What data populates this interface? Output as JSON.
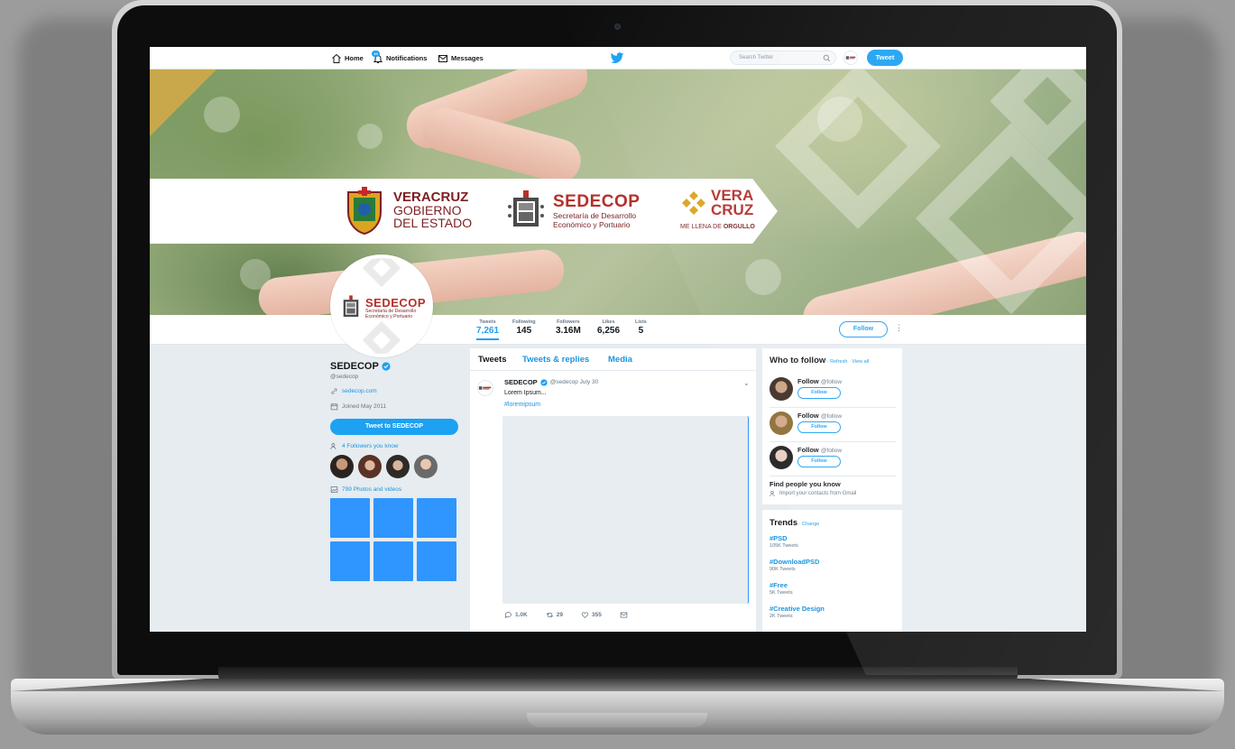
{
  "nav": {
    "home": "Home",
    "notifications": "Notifications",
    "notifications_count": "10",
    "messages": "Messages",
    "search_placeholder": "Search Twitter",
    "tweet_button": "Tweet"
  },
  "banner": {
    "veracruz_line1": "VERACRUZ",
    "veracruz_line2": "GOBIERNO",
    "veracruz_line3": "DEL ESTADO",
    "sedecop_title": "SEDECOP",
    "sedecop_sub1": "Secretaría de Desarrollo",
    "sedecop_sub2": "Económico y Portuario",
    "vc_line1": "VERA",
    "vc_line2": "CRUZ",
    "vc_tagline_a": "ME LLENA DE ",
    "vc_tagline_b": "ORGULLO"
  },
  "stats": [
    {
      "label": "Tweets",
      "value": "7,261"
    },
    {
      "label": "Following",
      "value": "145"
    },
    {
      "label": "Followers",
      "value": "3.16M"
    },
    {
      "label": "Likes",
      "value": "6,256"
    },
    {
      "label": "Lists",
      "value": "5"
    }
  ],
  "profile": {
    "name": "SEDECOP",
    "handle": "@sedecop",
    "website": "sedecop.com",
    "joined": "Joined May 2011",
    "follow_button": "Follow",
    "tweet_to": "Tweet to SEDECOP",
    "followers_you_know": "4 Followers you know",
    "photos_videos": "799 Photos and videos"
  },
  "timeline": {
    "tabs": [
      "Tweets",
      "Tweets & replies",
      "Media"
    ],
    "tweet": {
      "name": "SEDECOP",
      "handle_date": "@sedecop  July 30",
      "text": "Lorem Ipsum...",
      "hashtag": "#loremipsum",
      "replies": "1.0K",
      "retweets": "29",
      "likes": "355"
    }
  },
  "who_to_follow": {
    "title": "Who to follow",
    "links": " · Refresh · View all",
    "items": [
      {
        "name": "Follow",
        "handle": "@follow",
        "button": "Follow"
      },
      {
        "name": "Follow",
        "handle": "@follow",
        "button": "Follow"
      },
      {
        "name": "Follow",
        "handle": "@follow",
        "button": "Follow"
      }
    ],
    "find_title": "Find people you know",
    "find_sub": "Import your contacts from Gmail"
  },
  "trends": {
    "title": "Trends",
    "change": " · Change",
    "items": [
      {
        "name": "#PSD",
        "count": "105K Tweets"
      },
      {
        "name": "#DownloadPSD",
        "count": "90K Tweets"
      },
      {
        "name": "#Free",
        "count": "5K Tweets"
      },
      {
        "name": "#Creative Design",
        "count": "2K Tweets"
      }
    ]
  },
  "colors": {
    "accent": "#1da1f2",
    "link": "#1b95e0",
    "brand_red": "#b5302b",
    "tile_blue": "#2f96ff"
  }
}
